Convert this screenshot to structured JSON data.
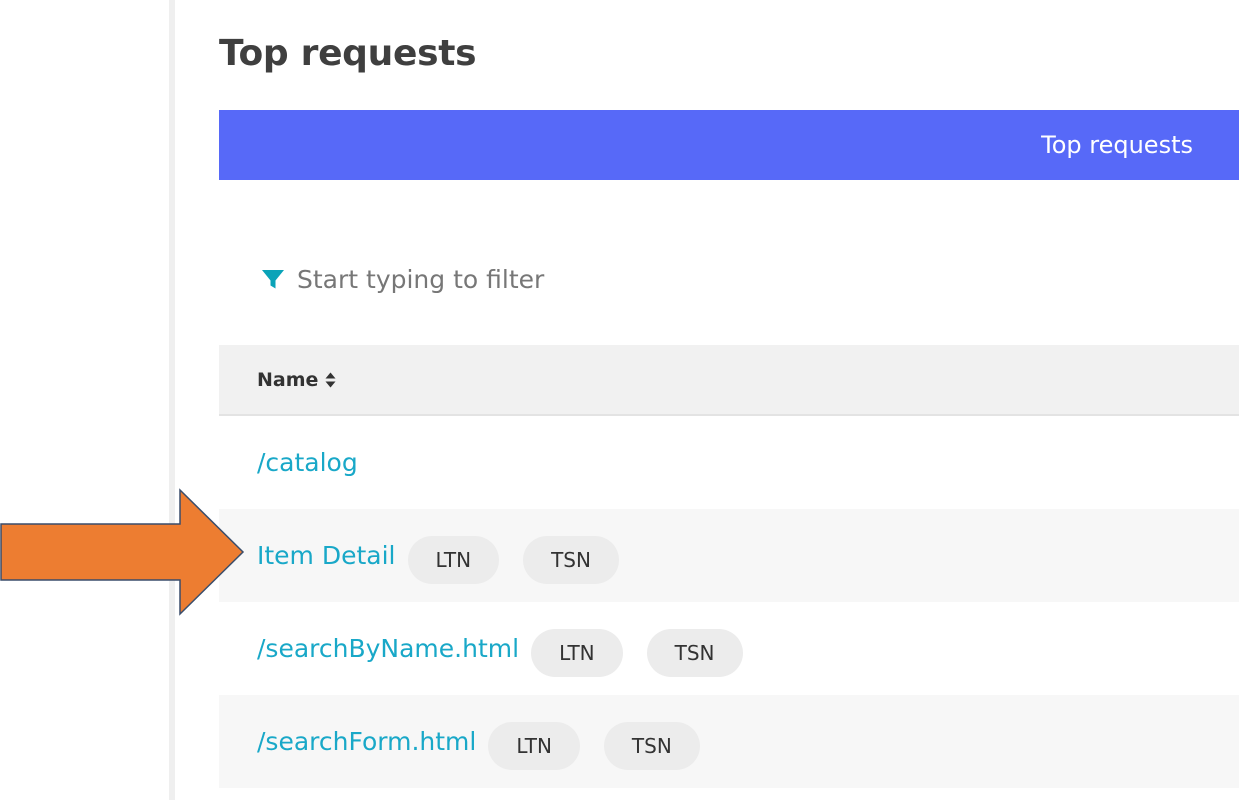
{
  "section": {
    "title": "Top requests"
  },
  "tab_bar": {
    "active_label": "Top requests",
    "color": "#5769f8"
  },
  "filter": {
    "placeholder": "Start typing to filter",
    "value": "",
    "icon": "filter-funnel-icon"
  },
  "table": {
    "columns": [
      {
        "label": "Name",
        "sortable": true,
        "sort_icon": "sort-updown-icon"
      }
    ],
    "rows": [
      {
        "name": "/catalog",
        "tags": []
      },
      {
        "name": "Item Detail",
        "tags": [
          "LTN",
          "TSN"
        ]
      },
      {
        "name": "/searchByName.html",
        "tags": [
          "LTN",
          "TSN"
        ]
      },
      {
        "name": "/searchForm.html",
        "tags": [
          "LTN",
          "TSN"
        ]
      }
    ]
  },
  "annotation": {
    "type": "arrow",
    "points_to_row": "Item Detail",
    "color": "#ed7d31"
  },
  "colors": {
    "link": "#19a8c8",
    "accent_icon": "#0aa3b8"
  }
}
